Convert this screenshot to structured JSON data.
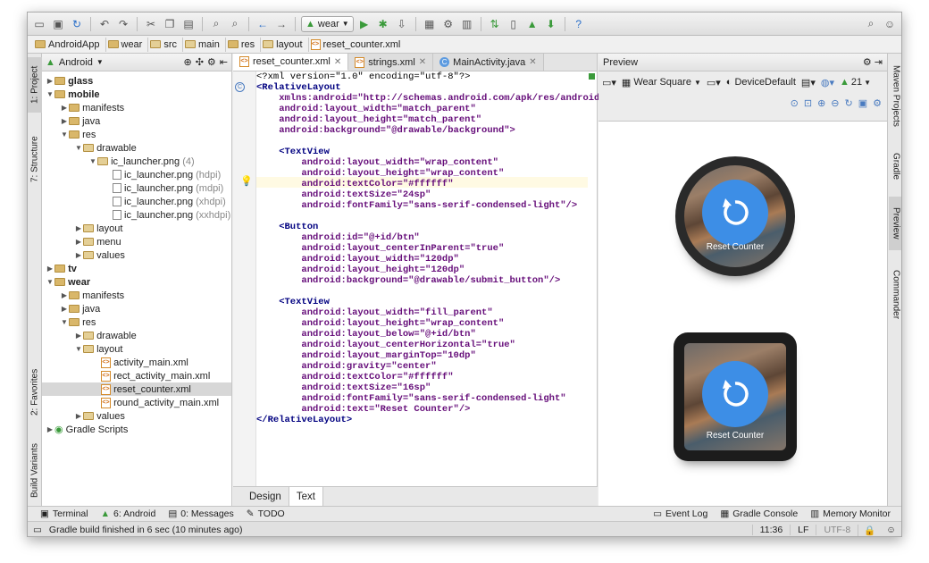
{
  "toolbar": {
    "config_value": "wear"
  },
  "breadcrumbs": [
    "AndroidApp",
    "wear",
    "src",
    "main",
    "res",
    "layout",
    "reset_counter.xml"
  ],
  "left_strip": {
    "project": "1: Project",
    "structure": "7: Structure",
    "favorites": "2: Favorites",
    "build_variants": "Build Variants"
  },
  "project_panel": {
    "view": "Android"
  },
  "tree": [
    {
      "label": "glass",
      "muted": ""
    },
    {
      "label": "mobile",
      "muted": ""
    },
    {
      "label": "manifests",
      "muted": ""
    },
    {
      "label": "java",
      "muted": ""
    },
    {
      "label": "res",
      "muted": ""
    },
    {
      "label": "drawable",
      "muted": ""
    },
    {
      "label": "ic_launcher.png",
      "muted": "(4)"
    },
    {
      "label": "ic_launcher.png",
      "muted": "(hdpi)"
    },
    {
      "label": "ic_launcher.png",
      "muted": "(mdpi)"
    },
    {
      "label": "ic_launcher.png",
      "muted": "(xhdpi)"
    },
    {
      "label": "ic_launcher.png",
      "muted": "(xxhdpi)"
    },
    {
      "label": "layout",
      "muted": ""
    },
    {
      "label": "menu",
      "muted": ""
    },
    {
      "label": "values",
      "muted": ""
    },
    {
      "label": "tv",
      "muted": ""
    },
    {
      "label": "wear",
      "muted": ""
    },
    {
      "label": "manifests",
      "muted": ""
    },
    {
      "label": "java",
      "muted": ""
    },
    {
      "label": "res",
      "muted": ""
    },
    {
      "label": "drawable",
      "muted": ""
    },
    {
      "label": "layout",
      "muted": ""
    },
    {
      "label": "activity_main.xml",
      "muted": ""
    },
    {
      "label": "rect_activity_main.xml",
      "muted": ""
    },
    {
      "label": "reset_counter.xml",
      "muted": ""
    },
    {
      "label": "round_activity_main.xml",
      "muted": ""
    },
    {
      "label": "values",
      "muted": ""
    },
    {
      "label": "Gradle Scripts",
      "muted": ""
    }
  ],
  "editor_tabs": [
    "reset_counter.xml",
    "strings.xml",
    "MainActivity.java"
  ],
  "code": {
    "l1": "<?xml version=\"1.0\" encoding=\"utf-8\"?>",
    "l2": "<RelativeLayout",
    "l3": "    xmlns:android=\"http://schemas.android.com/apk/res/android\"",
    "l4": "    android:layout_width=\"match_parent\"",
    "l5": "    android:layout_height=\"match_parent\"",
    "l6": "    android:background=\"@drawable/background\">",
    "l8": "    <TextView",
    "l9": "        android:layout_width=\"wrap_content\"",
    "l10": "        android:layout_height=\"wrap_content\"",
    "l11": "        android:textColor=\"#ffffff\"",
    "l12": "        android:textSize=\"24sp\"",
    "l13": "        android:fontFamily=\"sans-serif-condensed-light\"/>",
    "l15": "    <Button",
    "l16": "        android:id=\"@+id/btn\"",
    "l17": "        android:layout_centerInParent=\"true\"",
    "l18": "        android:layout_width=\"120dp\"",
    "l19": "        android:layout_height=\"120dp\"",
    "l20": "        android:background=\"@drawable/submit_button\"/>",
    "l22": "    <TextView",
    "l23": "        android:layout_width=\"fill_parent\"",
    "l24": "        android:layout_height=\"wrap_content\"",
    "l25": "        android:layout_below=\"@+id/btn\"",
    "l26": "        android:layout_centerHorizontal=\"true\"",
    "l27": "        android:layout_marginTop=\"10dp\"",
    "l28": "        android:gravity=\"center\"",
    "l29": "        android:textColor=\"#ffffff\"",
    "l30": "        android:textSize=\"16sp\"",
    "l31": "        android:fontFamily=\"sans-serif-condensed-light\"",
    "l32": "        android:text=\"Reset Counter\"/>",
    "l33": "</RelativeLayout>"
  },
  "editor_bottom": {
    "design": "Design",
    "text": "Text"
  },
  "preview": {
    "title": "Preview",
    "device": "Wear Square",
    "theme": "DeviceDefault",
    "api": "21",
    "watch_text": "Reset Counter"
  },
  "right_strip": {
    "maven": "Maven Projects",
    "gradle": "Gradle",
    "preview": "Preview",
    "commander": "Commander"
  },
  "tool_windows": {
    "terminal": "Terminal",
    "android": "6: Android",
    "messages": "0: Messages",
    "todo": "TODO",
    "event_log": "Event Log",
    "gradle_console": "Gradle Console",
    "memory": "Memory Monitor"
  },
  "status": {
    "message": "Gradle build finished in 6 sec (10 minutes ago)",
    "position": "11:36",
    "line_sep": "LF",
    "encoding": "UTF-8"
  },
  "colors": {
    "accent_blue": "#3d8ee6",
    "keyword": "#000080",
    "attr": "#660e7a",
    "string": "#008000"
  }
}
